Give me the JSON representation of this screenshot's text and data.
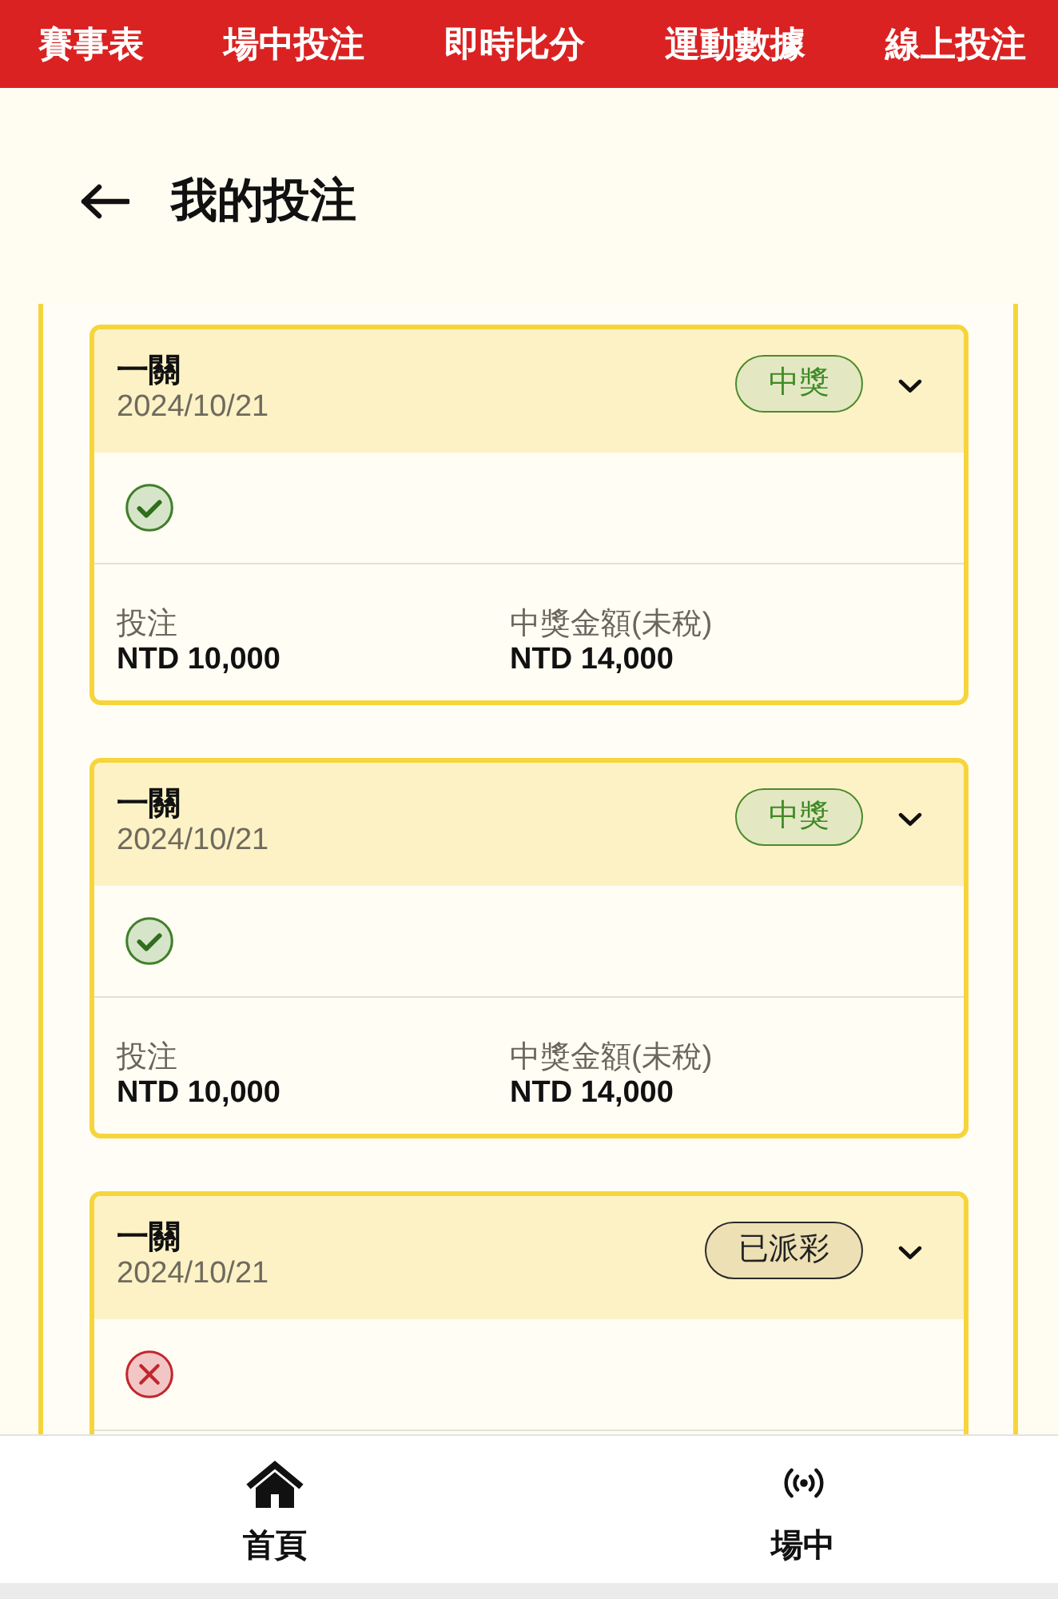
{
  "top_nav": {
    "items": [
      {
        "label": "賽事表"
      },
      {
        "label": "場中投注"
      },
      {
        "label": "即時比分"
      },
      {
        "label": "運動數據"
      },
      {
        "label": "線上投注"
      }
    ]
  },
  "page_header": {
    "title": "我的投注"
  },
  "bets": [
    {
      "title": "一關",
      "date": "2024/10/21",
      "status": {
        "kind": "won",
        "label": "中獎"
      },
      "result": {
        "kind": "win"
      },
      "stake_label": "投注",
      "stake": "NTD 10,000",
      "payout_label": "中獎金額(未稅)",
      "payout": "NTD 14,000"
    },
    {
      "title": "一關",
      "date": "2024/10/21",
      "status": {
        "kind": "won",
        "label": "中獎"
      },
      "result": {
        "kind": "win"
      },
      "stake_label": "投注",
      "stake": "NTD 10,000",
      "payout_label": "中獎金額(未稅)",
      "payout": "NTD 14,000"
    },
    {
      "title": "一關",
      "date": "2024/10/21",
      "status": {
        "kind": "paid",
        "label": "已派彩"
      },
      "result": {
        "kind": "loss"
      }
    }
  ],
  "bottom_nav": {
    "items": [
      {
        "kind": "home",
        "label": "首頁"
      },
      {
        "kind": "live",
        "label": "場中"
      }
    ]
  }
}
